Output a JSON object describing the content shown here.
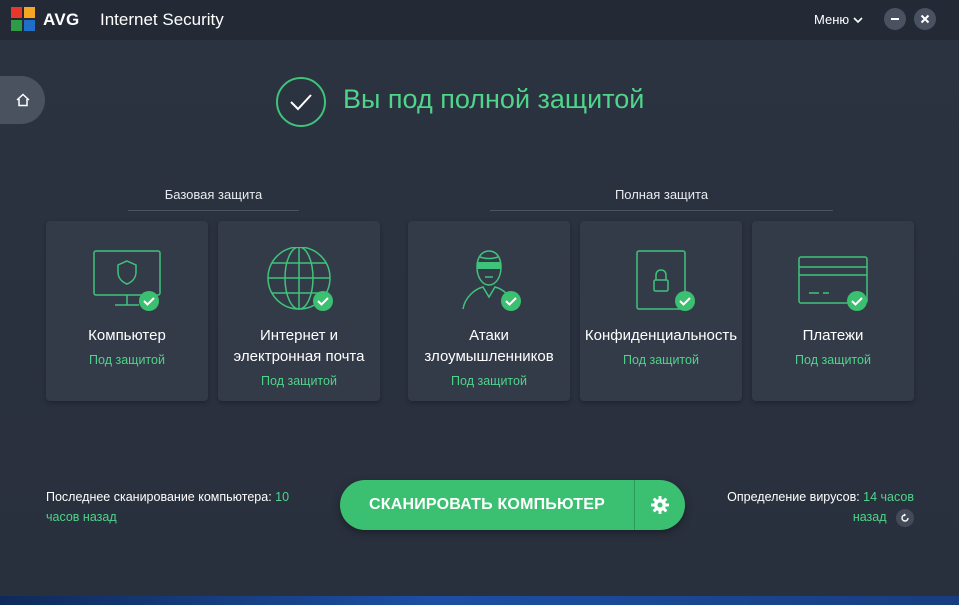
{
  "app": {
    "brand": "AVG",
    "product": "Internet Security",
    "menu_label": "Меню"
  },
  "status": {
    "title": "Вы под полной защитой"
  },
  "sections": [
    {
      "label": "Базовая защита"
    },
    {
      "label": "Полная защита"
    }
  ],
  "cards": [
    {
      "title": "Компьютер",
      "status": "Под защитой",
      "icon": "monitor-shield-icon"
    },
    {
      "title": "Интернет и\nэлектронная почта",
      "status": "Под защитой",
      "icon": "globe-icon"
    },
    {
      "title": "Атаки\nзлоумышленников",
      "status": "Под защитой",
      "icon": "hacker-icon"
    },
    {
      "title": "Конфиденциальность",
      "status": "Под защитой",
      "icon": "document-lock-icon"
    },
    {
      "title": "Платежи",
      "status": "Под защитой",
      "icon": "credit-card-icon"
    }
  ],
  "scan": {
    "last_scan_label": "Последнее сканирование компьютера:",
    "last_scan_value": "10 часов назад",
    "button_label": "СКАНИРОВАТЬ КОМПЬЮТЕР"
  },
  "definitions": {
    "label": "Определение вирусов:",
    "value_line1": "14 часов",
    "value_line2": "назад"
  },
  "colors": {
    "accent_green": "#3ac070",
    "status_green": "#4fd48a",
    "background": "#2b3240",
    "card": "#333b49"
  }
}
